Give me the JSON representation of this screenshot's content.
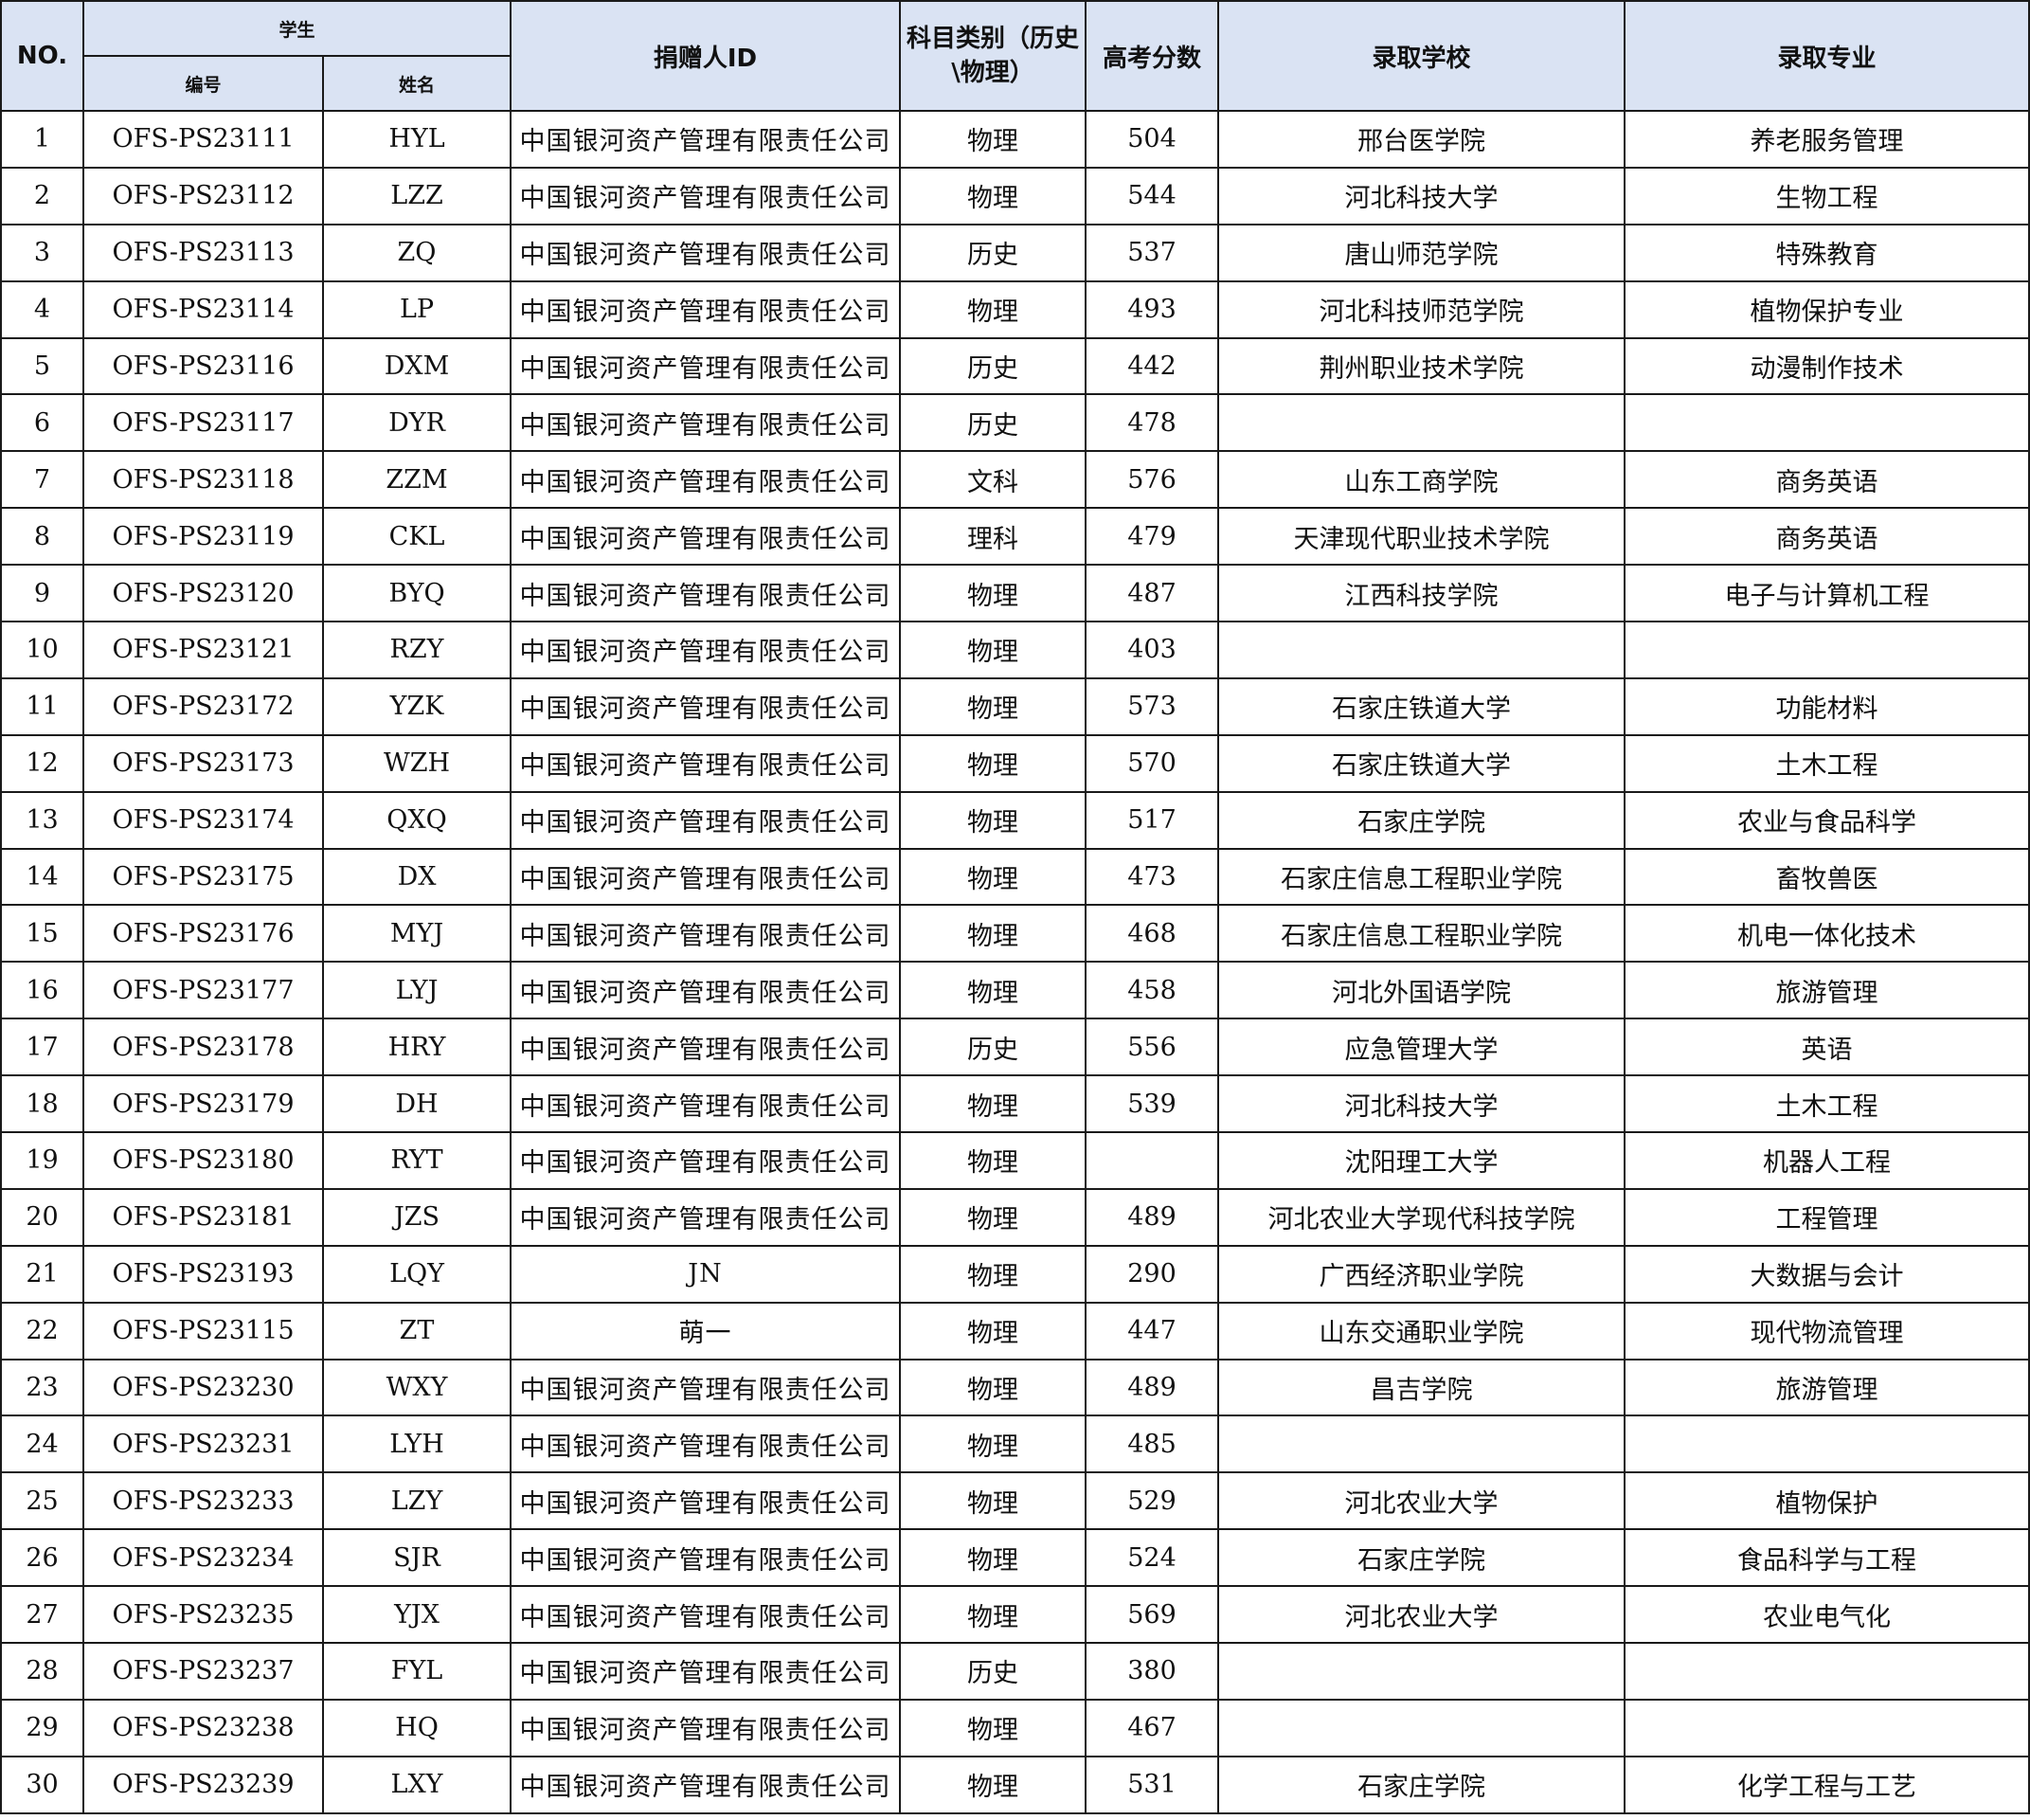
{
  "header": {
    "no": "NO.",
    "student": "学生",
    "student_id": "编号",
    "student_name": "姓名",
    "donor_id": "捐赠人ID",
    "subject": "科目类别（历史\\物理）",
    "score": "高考分数",
    "school": "录取学校",
    "major": "录取专业"
  },
  "rows": [
    {
      "no": "1",
      "id": "OFS-PS23111",
      "name": "HYL",
      "donor": "中国银河资产管理有限责任公司",
      "subject": "物理",
      "score": "504",
      "school": "邢台医学院",
      "major": "养老服务管理"
    },
    {
      "no": "2",
      "id": "OFS-PS23112",
      "name": "LZZ",
      "donor": "中国银河资产管理有限责任公司",
      "subject": "物理",
      "score": "544",
      "school": "河北科技大学",
      "major": "生物工程"
    },
    {
      "no": "3",
      "id": "OFS-PS23113",
      "name": "ZQ",
      "donor": "中国银河资产管理有限责任公司",
      "subject": "历史",
      "score": "537",
      "school": "唐山师范学院",
      "major": "特殊教育"
    },
    {
      "no": "4",
      "id": "OFS-PS23114",
      "name": "LP",
      "donor": "中国银河资产管理有限责任公司",
      "subject": "物理",
      "score": "493",
      "school": "河北科技师范学院",
      "major": "植物保护专业"
    },
    {
      "no": "5",
      "id": "OFS-PS23116",
      "name": "DXM",
      "donor": "中国银河资产管理有限责任公司",
      "subject": "历史",
      "score": "442",
      "school": "荆州职业技术学院",
      "major": "动漫制作技术"
    },
    {
      "no": "6",
      "id": "OFS-PS23117",
      "name": "DYR",
      "donor": "中国银河资产管理有限责任公司",
      "subject": "历史",
      "score": "478",
      "school": "",
      "major": ""
    },
    {
      "no": "7",
      "id": "OFS-PS23118",
      "name": "ZZM",
      "donor": "中国银河资产管理有限责任公司",
      "subject": "文科",
      "score": "576",
      "school": "山东工商学院",
      "major": "商务英语"
    },
    {
      "no": "8",
      "id": "OFS-PS23119",
      "name": "CKL",
      "donor": "中国银河资产管理有限责任公司",
      "subject": "理科",
      "score": "479",
      "school": "天津现代职业技术学院",
      "major": "商务英语"
    },
    {
      "no": "9",
      "id": "OFS-PS23120",
      "name": "BYQ",
      "donor": "中国银河资产管理有限责任公司",
      "subject": "物理",
      "score": "487",
      "school": "江西科技学院",
      "major": "电子与计算机工程"
    },
    {
      "no": "10",
      "id": "OFS-PS23121",
      "name": "RZY",
      "donor": "中国银河资产管理有限责任公司",
      "subject": "物理",
      "score": "403",
      "school": "",
      "major": ""
    },
    {
      "no": "11",
      "id": "OFS-PS23172",
      "name": "YZK",
      "donor": "中国银河资产管理有限责任公司",
      "subject": "物理",
      "score": "573",
      "school": "石家庄铁道大学",
      "major": "功能材料"
    },
    {
      "no": "12",
      "id": "OFS-PS23173",
      "name": "WZH",
      "donor": "中国银河资产管理有限责任公司",
      "subject": "物理",
      "score": "570",
      "school": "石家庄铁道大学",
      "major": "土木工程"
    },
    {
      "no": "13",
      "id": "OFS-PS23174",
      "name": "QXQ",
      "donor": "中国银河资产管理有限责任公司",
      "subject": "物理",
      "score": "517",
      "school": "石家庄学院",
      "major": "农业与食品科学"
    },
    {
      "no": "14",
      "id": "OFS-PS23175",
      "name": "DX",
      "donor": "中国银河资产管理有限责任公司",
      "subject": "物理",
      "score": "473",
      "school": "石家庄信息工程职业学院",
      "major": "畜牧兽医"
    },
    {
      "no": "15",
      "id": "OFS-PS23176",
      "name": "MYJ",
      "donor": "中国银河资产管理有限责任公司",
      "subject": "物理",
      "score": "468",
      "school": "石家庄信息工程职业学院",
      "major": "机电一体化技术"
    },
    {
      "no": "16",
      "id": "OFS-PS23177",
      "name": "LYJ",
      "donor": "中国银河资产管理有限责任公司",
      "subject": "物理",
      "score": "458",
      "school": "河北外国语学院",
      "major": "旅游管理"
    },
    {
      "no": "17",
      "id": "OFS-PS23178",
      "name": "HRY",
      "donor": "中国银河资产管理有限责任公司",
      "subject": "历史",
      "score": "556",
      "school": "应急管理大学",
      "major": "英语"
    },
    {
      "no": "18",
      "id": "OFS-PS23179",
      "name": "DH",
      "donor": "中国银河资产管理有限责任公司",
      "subject": "物理",
      "score": "539",
      "school": "河北科技大学",
      "major": "土木工程"
    },
    {
      "no": "19",
      "id": "OFS-PS23180",
      "name": "RYT",
      "donor": "中国银河资产管理有限责任公司",
      "subject": "物理",
      "score": "",
      "school": "沈阳理工大学",
      "major": "机器人工程"
    },
    {
      "no": "20",
      "id": "OFS-PS23181",
      "name": "JZS",
      "donor": "中国银河资产管理有限责任公司",
      "subject": "物理",
      "score": "489",
      "school": "河北农业大学现代科技学院",
      "major": "工程管理"
    },
    {
      "no": "21",
      "id": "OFS-PS23193",
      "name": "LQY",
      "donor": "JN",
      "subject": "物理",
      "score": "290",
      "school": "广西经济职业学院",
      "major": "大数据与会计"
    },
    {
      "no": "22",
      "id": "OFS-PS23115",
      "name": "ZT",
      "donor": "萌一",
      "subject": "物理",
      "score": "447",
      "school": "山东交通职业学院",
      "major": "现代物流管理"
    },
    {
      "no": "23",
      "id": "OFS-PS23230",
      "name": "WXY",
      "donor": "中国银河资产管理有限责任公司",
      "subject": "物理",
      "score": "489",
      "school": "昌吉学院",
      "major": "旅游管理"
    },
    {
      "no": "24",
      "id": "OFS-PS23231",
      "name": "LYH",
      "donor": "中国银河资产管理有限责任公司",
      "subject": "物理",
      "score": "485",
      "school": "",
      "major": ""
    },
    {
      "no": "25",
      "id": "OFS-PS23233",
      "name": "LZY",
      "donor": "中国银河资产管理有限责任公司",
      "subject": "物理",
      "score": "529",
      "school": "河北农业大学",
      "major": "植物保护"
    },
    {
      "no": "26",
      "id": "OFS-PS23234",
      "name": "SJR",
      "donor": "中国银河资产管理有限责任公司",
      "subject": "物理",
      "score": "524",
      "school": "石家庄学院",
      "major": "食品科学与工程"
    },
    {
      "no": "27",
      "id": "OFS-PS23235",
      "name": "YJX",
      "donor": "中国银河资产管理有限责任公司",
      "subject": "物理",
      "score": "569",
      "school": "河北农业大学",
      "major": "农业电气化"
    },
    {
      "no": "28",
      "id": "OFS-PS23237",
      "name": "FYL",
      "donor": "中国银河资产管理有限责任公司",
      "subject": "历史",
      "score": "380",
      "school": "",
      "major": ""
    },
    {
      "no": "29",
      "id": "OFS-PS23238",
      "name": "HQ",
      "donor": "中国银河资产管理有限责任公司",
      "subject": "物理",
      "score": "467",
      "school": "",
      "major": ""
    },
    {
      "no": "30",
      "id": "OFS-PS23239",
      "name": "LXY",
      "donor": "中国银河资产管理有限责任公司",
      "subject": "物理",
      "score": "531",
      "school": "石家庄学院",
      "major": "化学工程与工艺"
    }
  ]
}
